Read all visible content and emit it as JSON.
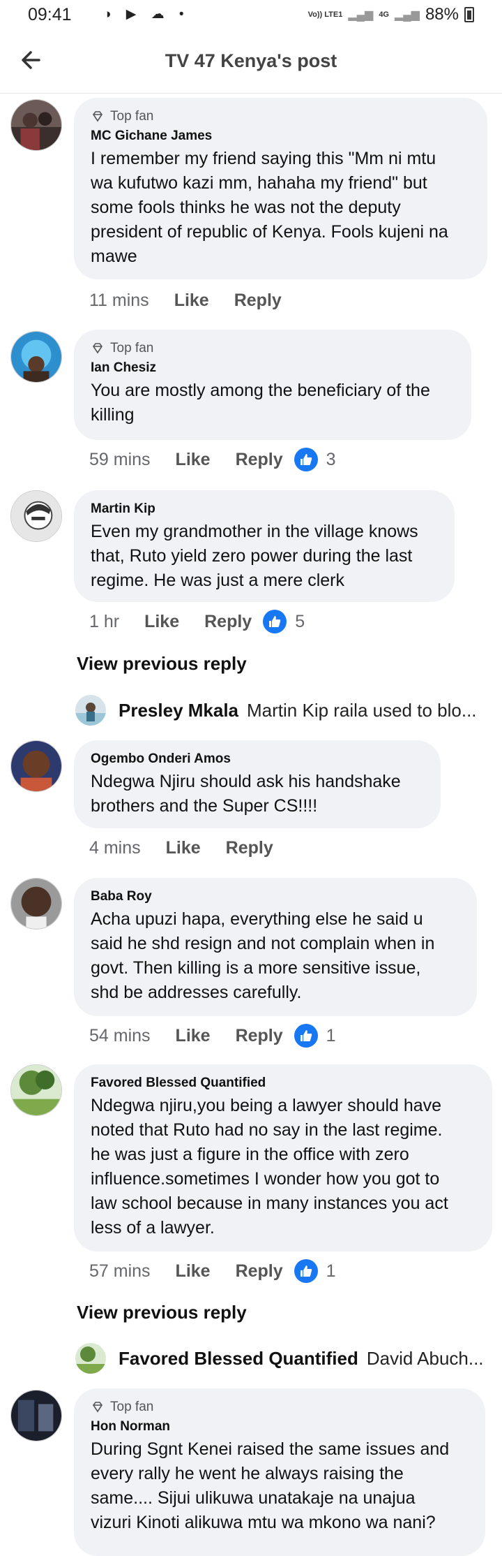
{
  "status": {
    "time": "09:41",
    "icons_left": "◑ ▶ ☁ •",
    "volte": "Vo)) LTE1",
    "network": "4G",
    "battery": "88%"
  },
  "header": {
    "title": "TV 47 Kenya's post"
  },
  "labels": {
    "top_fan": "Top fan",
    "like": "Like",
    "reply": "Reply",
    "view_previous": "View previous reply"
  },
  "comments": [
    {
      "author": "MC Gichane James",
      "top_fan": true,
      "lines": [
        "I remember my friend saying this \"Mm ni mtu",
        "wa kufutwo kazi mm, hahaha my friend\" but",
        "some fools thinks he was not the deputy",
        "president of republic of Kenya. Fools kujeni na",
        "mawe"
      ],
      "time": "11 mins",
      "reactions": ""
    },
    {
      "author": "Ian Chesiz",
      "top_fan": true,
      "lines": [
        "You are mostly among the beneficiary of the",
        "killing"
      ],
      "time": "59 mins",
      "reactions": "3"
    },
    {
      "author": "Martin Kip",
      "top_fan": false,
      "lines": [
        "Even my grandmother in the village knows",
        "that, Ruto yield zero power during the last",
        "regime. He was just a mere clerk"
      ],
      "time": "1 hr",
      "reactions": "5"
    },
    {
      "author": "Ogembo Onderi Amos",
      "top_fan": false,
      "lines": [
        "Ndegwa Njiru should ask his handshake",
        "brothers and the Super CS!!!!"
      ],
      "time": "4 mins",
      "reactions": ""
    },
    {
      "author": "Baba Roy",
      "top_fan": false,
      "lines": [
        "Acha upuzi hapa, everything else he said u",
        "said he shd resign and not complain when in",
        "govt. Then killing is a more sensitive issue,",
        "shd be addresses carefully."
      ],
      "time": "54 mins",
      "reactions": "1"
    },
    {
      "author": "Favored Blessed Quantified",
      "top_fan": false,
      "lines": [
        "Ndegwa njiru,you being a lawyer should have",
        "noted that Ruto had no say in the last regime.",
        "he was just a figure in the office with zero",
        "influence.sometimes I wonder how you got to",
        "law school because in many instances you act",
        "less of a lawyer."
      ],
      "time": "57 mins",
      "reactions": "1"
    },
    {
      "author": "Hon Norman",
      "top_fan": true,
      "lines": [
        "During Sgnt Kenei raised the same issues and",
        "every rally he went he always raising the",
        "same.... Sijui ulikuwa unatakaje na unajua",
        "vizuri Kinoti alikuwa mtu wa mkono wa nani?"
      ],
      "time": "",
      "reactions": ""
    }
  ],
  "reply_previews": [
    {
      "name": "Presley Mkala",
      "text": "Martin Kip raila used to blo..."
    },
    {
      "name": "Favored Blessed Quantified",
      "text": "David Abuch..."
    }
  ],
  "colors": {
    "like_blue": "#1877f2",
    "bubble": "#f0f2f5",
    "meta": "#65676b"
  }
}
